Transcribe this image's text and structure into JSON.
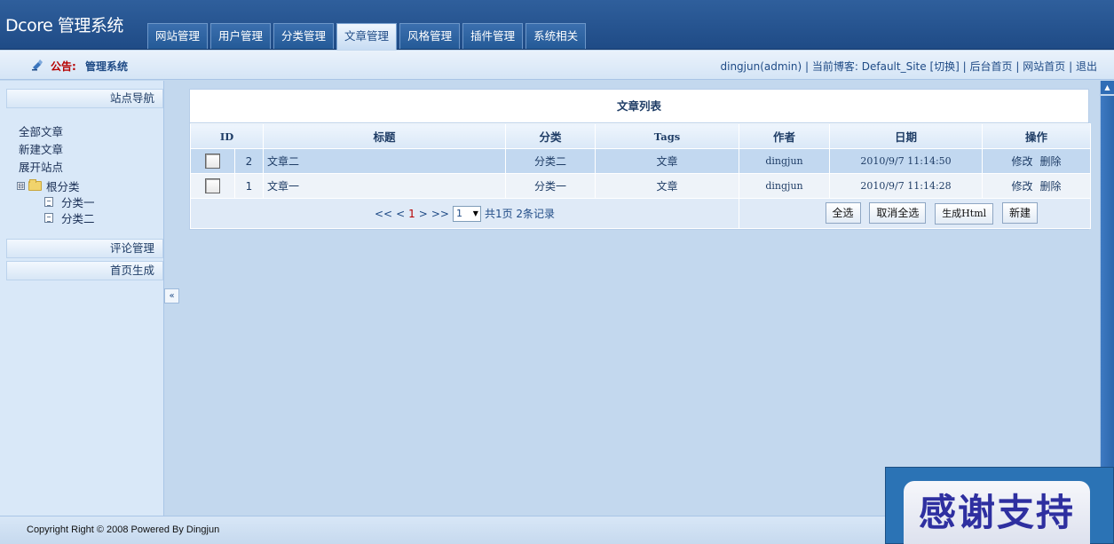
{
  "app": {
    "title": "Dcore 管理系统"
  },
  "nav": {
    "tabs": [
      {
        "label": "网站管理"
      },
      {
        "label": "用户管理"
      },
      {
        "label": "分类管理"
      },
      {
        "label": "文章管理"
      },
      {
        "label": "风格管理"
      },
      {
        "label": "插件管理"
      },
      {
        "label": "系统相关"
      }
    ],
    "active": "文章管理"
  },
  "notice": {
    "label": "公告:",
    "text": "管理系统"
  },
  "user_links": {
    "user": "dingjun(admin)",
    "current_blog": "当前博客: Default_Site",
    "switch": "[切换]",
    "admin_home": "后台首页",
    "site_home": "网站首页",
    "logout": "退出",
    "sep": "|"
  },
  "sidebar": {
    "nav_title": "站点导航",
    "links": [
      "全部文章",
      "新建文章",
      "展开站点"
    ],
    "tree": {
      "toggle": "⊟",
      "root": "根分类",
      "children": [
        "分类一",
        "分类二"
      ]
    },
    "comment_title": "评论管理",
    "home_gen_title": "首页生成",
    "collapse": "«"
  },
  "article_list": {
    "title": "文章列表",
    "columns": [
      "ID",
      "标题",
      "分类",
      "Tags",
      "作者",
      "日期",
      "操作"
    ],
    "rows": [
      {
        "id": "2",
        "title": "文章二",
        "category": "分类二",
        "tags": "文章",
        "author": "dingjun",
        "date": "2010/9/7 11:14:50",
        "edit": "修改",
        "delete": "删除"
      },
      {
        "id": "1",
        "title": "文章一",
        "category": "分类一",
        "tags": "文章",
        "author": "dingjun",
        "date": "2010/9/7 11:14:28",
        "edit": "修改",
        "delete": "删除"
      }
    ],
    "pager": {
      "first": "<<",
      "prev": "<",
      "current": "1",
      "next": ">",
      "last": ">>",
      "select_value": "1",
      "summary": "共1页 2条记录"
    },
    "buttons": {
      "select_all": "全选",
      "deselect_all": "取消全选",
      "generate_html": "生成Html",
      "new": "新建"
    }
  },
  "footer": {
    "copyright": "Copyright Right © 2008 Powered By Dingjun"
  },
  "overlay": {
    "text": "感谢支持"
  },
  "colors": {
    "header": "#2f5f9c",
    "accent_red": "#b60000",
    "background": "#c3d8ee"
  }
}
